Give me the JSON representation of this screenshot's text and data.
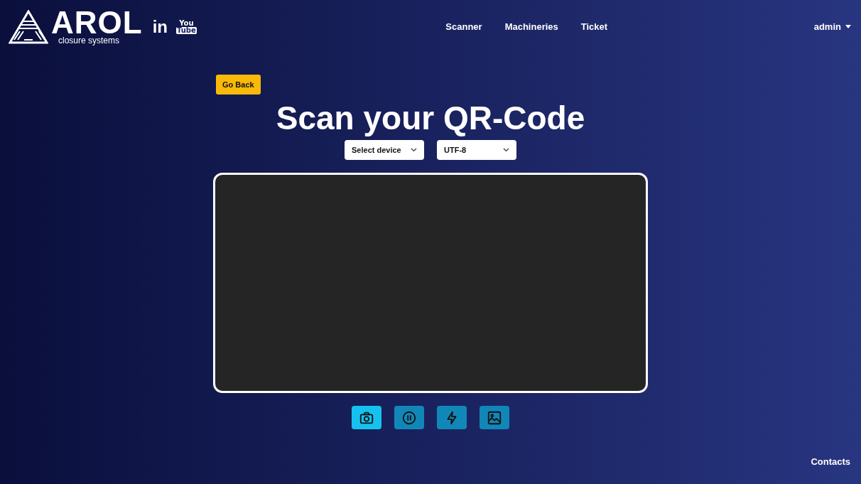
{
  "header": {
    "logo": {
      "name": "AROL",
      "tagline": "closure systems"
    },
    "social": [
      {
        "kind": "linkedin",
        "label": "in"
      },
      {
        "kind": "youtube",
        "label": "You",
        "label2": "Tube"
      }
    ],
    "nav": [
      "Scanner",
      "Machineries",
      "Ticket"
    ],
    "user": "admin"
  },
  "back_button": "Go Back",
  "title": "Scan your QR-Code",
  "selects": [
    {
      "value": "Select device"
    },
    {
      "value": "UTF-8"
    }
  ],
  "controls": [
    {
      "kind": "camera",
      "selected": true
    },
    {
      "kind": "pause",
      "selected": false
    },
    {
      "kind": "flash",
      "selected": false
    },
    {
      "kind": "image",
      "selected": false
    }
  ],
  "footer": {
    "link": "Contacts"
  }
}
